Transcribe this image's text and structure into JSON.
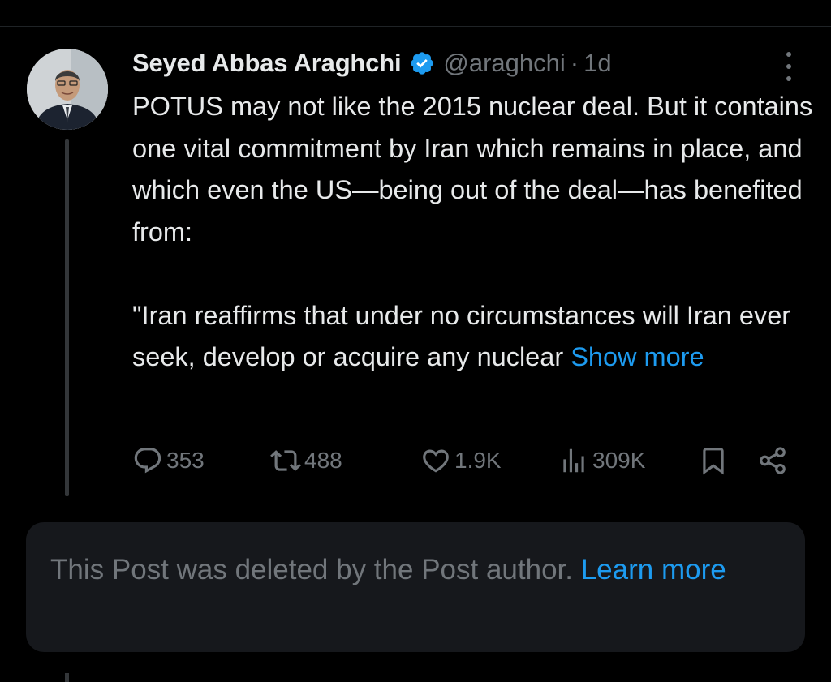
{
  "post": {
    "author_name": "Seyed Abbas Araghchi",
    "handle": "@araghchi",
    "separator": "·",
    "time": "1d",
    "avatar_icon": "user-avatar-photo",
    "verified_icon": "verified-badge-icon",
    "paragraphs": [
      "POTUS may not like the 2015 nuclear deal. But it contains one vital commitment by Iran which remains in place, and which even the US—being out of the deal—has benefited from:",
      "\"Iran reaffirms that under no circumstances will Iran ever seek, develop or acquire any nuclear"
    ],
    "show_more_label": "Show more"
  },
  "actions": {
    "replies": "353",
    "reposts": "488",
    "likes": "1.9K",
    "views": "309K"
  },
  "notice": {
    "text": "This Post was deleted by the Post author.",
    "link_label": "Learn more"
  },
  "colors": {
    "background": "#000000",
    "text_primary": "#e7e9ea",
    "text_secondary": "#71767b",
    "accent": "#1d9bf0",
    "notice_bg": "#16181c"
  }
}
